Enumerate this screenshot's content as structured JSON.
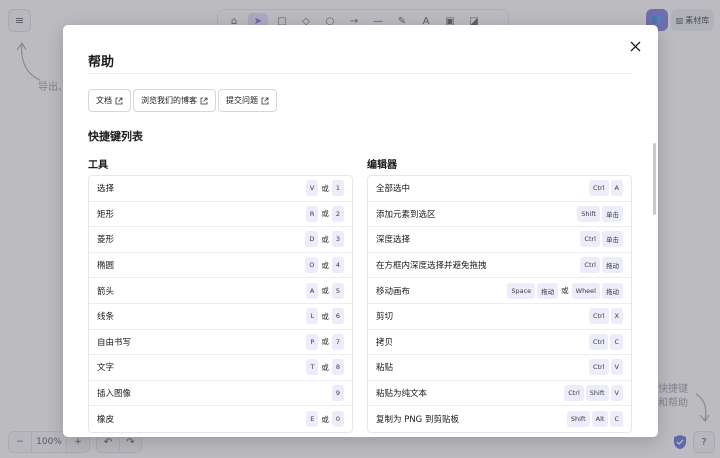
{
  "background": {
    "hint_left": "导出、",
    "hint_right_line1": "快捷键",
    "hint_right_line2": "和帮助",
    "zoom_level": "100%",
    "zoom_minus": "−",
    "zoom_plus": "+",
    "library_label": "素材库",
    "accent_color": "#6965db"
  },
  "dialog": {
    "title": "帮助",
    "links": [
      {
        "label": "文档"
      },
      {
        "label": "浏览我们的博客"
      },
      {
        "label": "提交问题"
      }
    ],
    "section_title": "快捷键列表",
    "or_text": "或",
    "tools": {
      "title": "工具",
      "rows": [
        {
          "label": "选择",
          "keys": [
            "V"
          ],
          "alt_keys": [
            "1"
          ]
        },
        {
          "label": "矩形",
          "keys": [
            "R"
          ],
          "alt_keys": [
            "2"
          ]
        },
        {
          "label": "菱形",
          "keys": [
            "D"
          ],
          "alt_keys": [
            "3"
          ]
        },
        {
          "label": "椭圆",
          "keys": [
            "O"
          ],
          "alt_keys": [
            "4"
          ]
        },
        {
          "label": "箭头",
          "keys": [
            "A"
          ],
          "alt_keys": [
            "5"
          ]
        },
        {
          "label": "线条",
          "keys": [
            "L"
          ],
          "alt_keys": [
            "6"
          ]
        },
        {
          "label": "自由书写",
          "keys": [
            "P"
          ],
          "alt_keys": [
            "7"
          ]
        },
        {
          "label": "文字",
          "keys": [
            "T"
          ],
          "alt_keys": [
            "8"
          ]
        },
        {
          "label": "插入图像",
          "keys": [
            "9"
          ],
          "alt_keys": []
        },
        {
          "label": "橡皮",
          "keys": [
            "E"
          ],
          "alt_keys": [
            "0"
          ]
        }
      ]
    },
    "editor": {
      "title": "编辑器",
      "rows": [
        {
          "label": "全部选中",
          "keys": [
            "Ctrl",
            "A"
          ],
          "alt_keys": []
        },
        {
          "label": "添加元素到选区",
          "keys": [
            "Shift",
            "单击"
          ],
          "alt_keys": []
        },
        {
          "label": "深度选择",
          "keys": [
            "Ctrl",
            "单击"
          ],
          "alt_keys": []
        },
        {
          "label": "在方框内深度选择并避免拖拽",
          "keys": [
            "Ctrl",
            "拖动"
          ],
          "alt_keys": []
        },
        {
          "label": "移动画布",
          "keys": [
            "Space",
            "拖动"
          ],
          "alt_keys": [
            "Wheel",
            "拖动"
          ]
        },
        {
          "label": "剪切",
          "keys": [
            "Ctrl",
            "X"
          ],
          "alt_keys": []
        },
        {
          "label": "拷贝",
          "keys": [
            "Ctrl",
            "C"
          ],
          "alt_keys": []
        },
        {
          "label": "粘贴",
          "keys": [
            "Ctrl",
            "V"
          ],
          "alt_keys": []
        },
        {
          "label": "粘贴为纯文本",
          "keys": [
            "Ctrl",
            "Shift",
            "V"
          ],
          "alt_keys": []
        },
        {
          "label": "复制为 PNG 到剪贴板",
          "keys": [
            "Shift",
            "Alt",
            "C"
          ],
          "alt_keys": []
        }
      ]
    }
  }
}
